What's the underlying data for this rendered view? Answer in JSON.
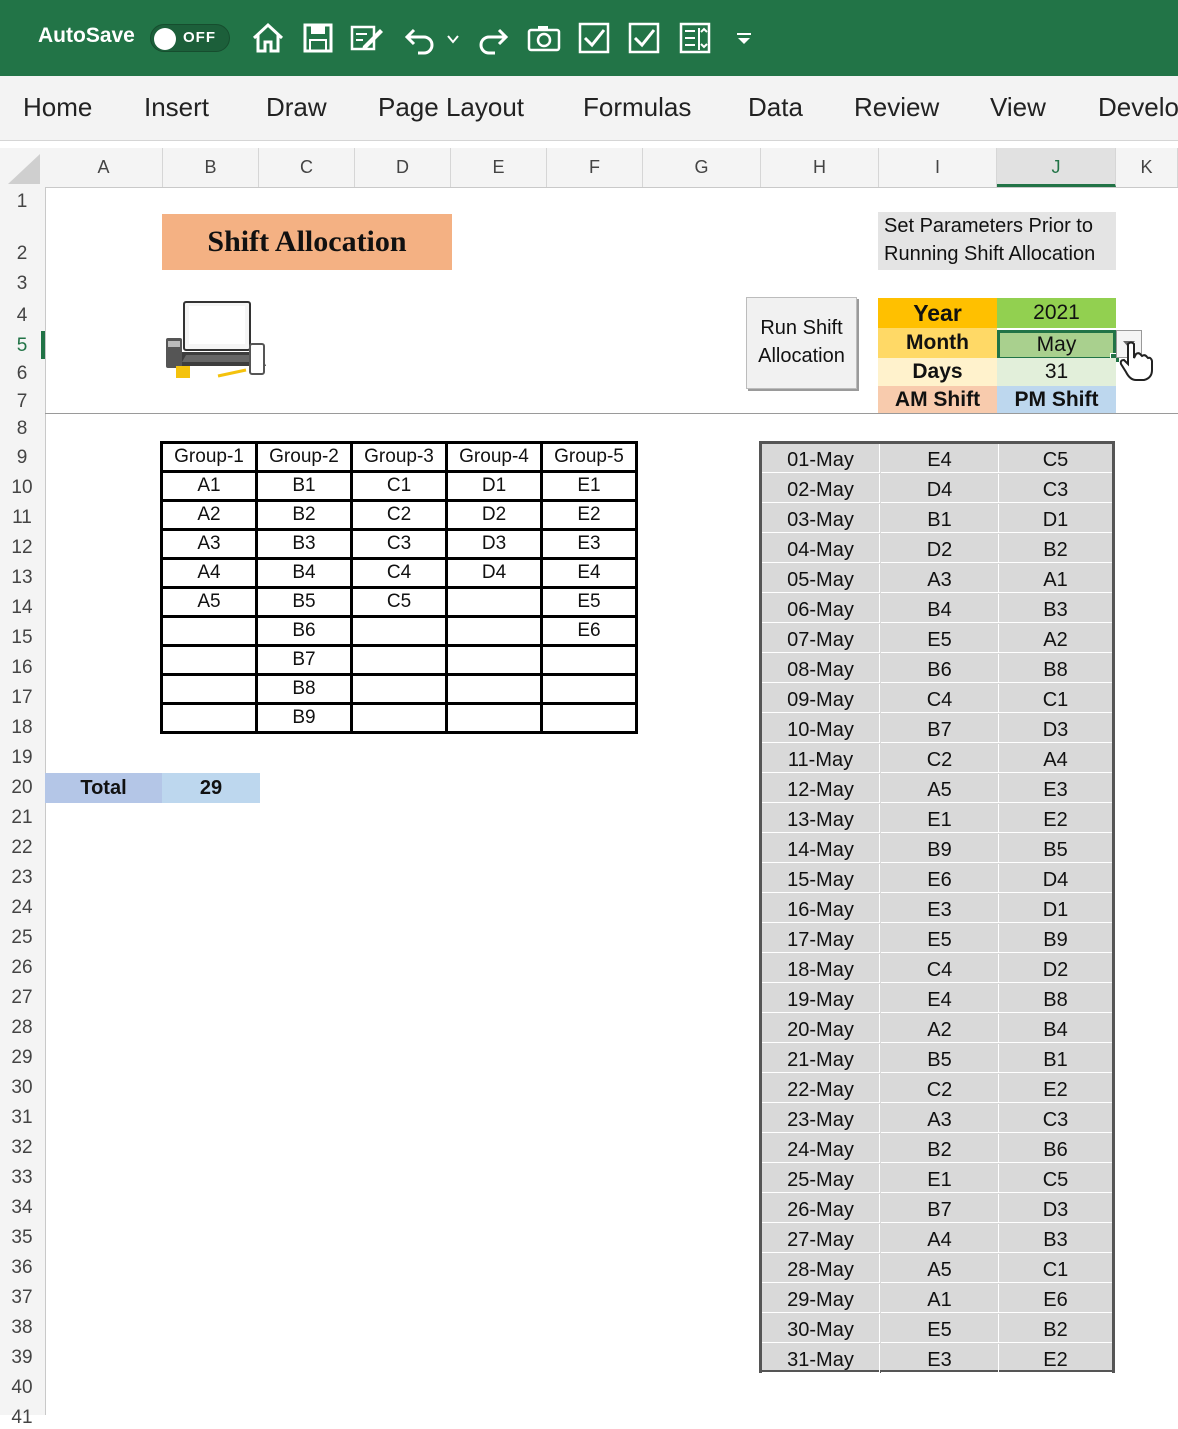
{
  "toolbar": {
    "autosave_label": "AutoSave",
    "autosave_state": "OFF",
    "icons": [
      "home-icon",
      "save-icon",
      "edit-document-icon",
      "undo-icon",
      "chevron-down-icon",
      "redo-icon",
      "camera-icon",
      "checkbox-icon",
      "checkbox-icon",
      "form-icon",
      "customize-toolbar-icon"
    ]
  },
  "ribbon": {
    "tabs": [
      "Home",
      "Insert",
      "Draw",
      "Page Layout",
      "Formulas",
      "Data",
      "Review",
      "View",
      "Develo"
    ]
  },
  "columns": [
    "A",
    "B",
    "C",
    "D",
    "E",
    "F",
    "G",
    "H",
    "I",
    "J",
    "K"
  ],
  "rows": [
    "1",
    "2",
    "3",
    "4",
    "5",
    "6",
    "7",
    "8",
    "9",
    "10",
    "11",
    "12",
    "13",
    "14",
    "15",
    "16",
    "17",
    "18",
    "19",
    "20",
    "21",
    "22",
    "23",
    "24",
    "25",
    "26",
    "27",
    "28",
    "29",
    "30",
    "31",
    "32",
    "33",
    "34",
    "35",
    "36",
    "37",
    "38",
    "39",
    "40",
    "41"
  ],
  "sheet": {
    "title": "Shift Allocation",
    "param_note": [
      "Set Parameters Prior to",
      "Running Shift Allocation"
    ],
    "run_button": [
      "Run Shift",
      "Allocation"
    ],
    "params": {
      "year_label": "Year",
      "year_value": "2021",
      "month_label": "Month",
      "month_value": "May",
      "days_label": "Days",
      "days_value": "31",
      "am_label": "AM Shift",
      "pm_label": "PM Shift"
    },
    "groups": {
      "headers": [
        "Group-1",
        "Group-2",
        "Group-3",
        "Group-4",
        "Group-5"
      ],
      "rows": [
        [
          "A1",
          "B1",
          "C1",
          "D1",
          "E1"
        ],
        [
          "A2",
          "B2",
          "C2",
          "D2",
          "E2"
        ],
        [
          "A3",
          "B3",
          "C3",
          "D3",
          "E3"
        ],
        [
          "A4",
          "B4",
          "C4",
          "D4",
          "E4"
        ],
        [
          "A5",
          "B5",
          "C5",
          "",
          "E5"
        ],
        [
          "",
          "B6",
          "",
          "",
          "E6"
        ],
        [
          "",
          "B7",
          "",
          "",
          ""
        ],
        [
          "",
          "B8",
          "",
          "",
          ""
        ],
        [
          "",
          "B9",
          "",
          "",
          ""
        ]
      ]
    },
    "total_label": "Total",
    "total_value": "29",
    "schedule": [
      [
        "01-May",
        "E4",
        "C5"
      ],
      [
        "02-May",
        "D4",
        "C3"
      ],
      [
        "03-May",
        "B1",
        "D1"
      ],
      [
        "04-May",
        "D2",
        "B2"
      ],
      [
        "05-May",
        "A3",
        "A1"
      ],
      [
        "06-May",
        "B4",
        "B3"
      ],
      [
        "07-May",
        "E5",
        "A2"
      ],
      [
        "08-May",
        "B6",
        "B8"
      ],
      [
        "09-May",
        "C4",
        "C1"
      ],
      [
        "10-May",
        "B7",
        "D3"
      ],
      [
        "11-May",
        "C2",
        "A4"
      ],
      [
        "12-May",
        "A5",
        "E3"
      ],
      [
        "13-May",
        "E1",
        "E2"
      ],
      [
        "14-May",
        "B9",
        "B5"
      ],
      [
        "15-May",
        "E6",
        "D4"
      ],
      [
        "16-May",
        "E3",
        "D1"
      ],
      [
        "17-May",
        "E5",
        "B9"
      ],
      [
        "18-May",
        "C4",
        "D2"
      ],
      [
        "19-May",
        "E4",
        "B8"
      ],
      [
        "20-May",
        "A2",
        "B4"
      ],
      [
        "21-May",
        "B5",
        "B1"
      ],
      [
        "22-May",
        "C2",
        "E2"
      ],
      [
        "23-May",
        "A3",
        "C3"
      ],
      [
        "24-May",
        "B2",
        "B6"
      ],
      [
        "25-May",
        "E1",
        "C5"
      ],
      [
        "26-May",
        "B7",
        "D3"
      ],
      [
        "27-May",
        "A4",
        "B3"
      ],
      [
        "28-May",
        "A5",
        "C1"
      ],
      [
        "29-May",
        "A1",
        "E6"
      ],
      [
        "30-May",
        "E5",
        "B2"
      ],
      [
        "31-May",
        "E3",
        "E2"
      ]
    ]
  },
  "colors": {
    "excel_green": "#227447",
    "title_fill": "#f4b183",
    "year_label_fill": "#ffc000",
    "month_label_fill": "#ffd966",
    "days_label_fill": "#fff2cc",
    "am_label_fill": "#f8cbad",
    "year_value_fill": "#92d050",
    "month_value_fill": "#a9d08e",
    "days_value_fill": "#e2efda",
    "pm_label_fill": "#bdd7ee"
  }
}
